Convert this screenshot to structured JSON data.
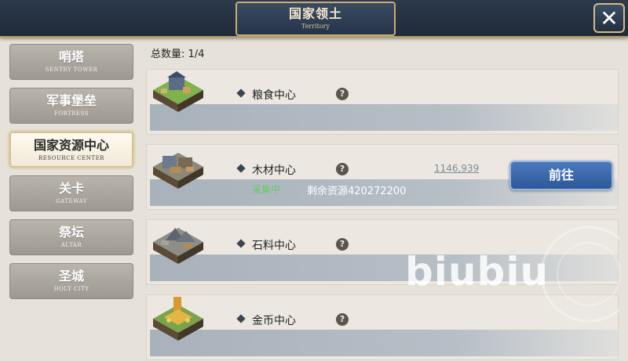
{
  "header": {
    "title_cn": "国家领土",
    "title_en": "Territory",
    "close_icon": "close-icon"
  },
  "sidebar": {
    "tabs": [
      {
        "cn": "哨塔",
        "en": "SENTRY TOWER",
        "active": false
      },
      {
        "cn": "军事堡垒",
        "en": "FORTRESS",
        "active": false
      },
      {
        "cn": "国家资源中心",
        "en": "RESOURCE CENTER",
        "active": true
      },
      {
        "cn": "关卡",
        "en": "GATEWAY",
        "active": false
      },
      {
        "cn": "祭坛",
        "en": "ALTAR",
        "active": false
      },
      {
        "cn": "圣城",
        "en": "HOLY CITY",
        "active": false
      }
    ]
  },
  "main": {
    "total_label": "总数量: 1/4",
    "centers": [
      {
        "name": "粮食中心",
        "help": "?",
        "icon": "farm-building-icon"
      },
      {
        "name": "木材中心",
        "help": "?",
        "icon": "lumber-building-icon",
        "status": "采集中",
        "remaining": "剩余资源420272200",
        "distance": "1146,939",
        "go_label": "前往"
      },
      {
        "name": "石料中心",
        "help": "?",
        "icon": "quarry-building-icon"
      },
      {
        "name": "金币中心",
        "help": "?",
        "icon": "gold-building-icon"
      }
    ]
  },
  "watermark": "biubiu",
  "colors": {
    "header_bg": "#26344a",
    "accent_gold": "#c9ad74",
    "go_button": "#3a68ab",
    "status_green": "#5fcf5f"
  }
}
